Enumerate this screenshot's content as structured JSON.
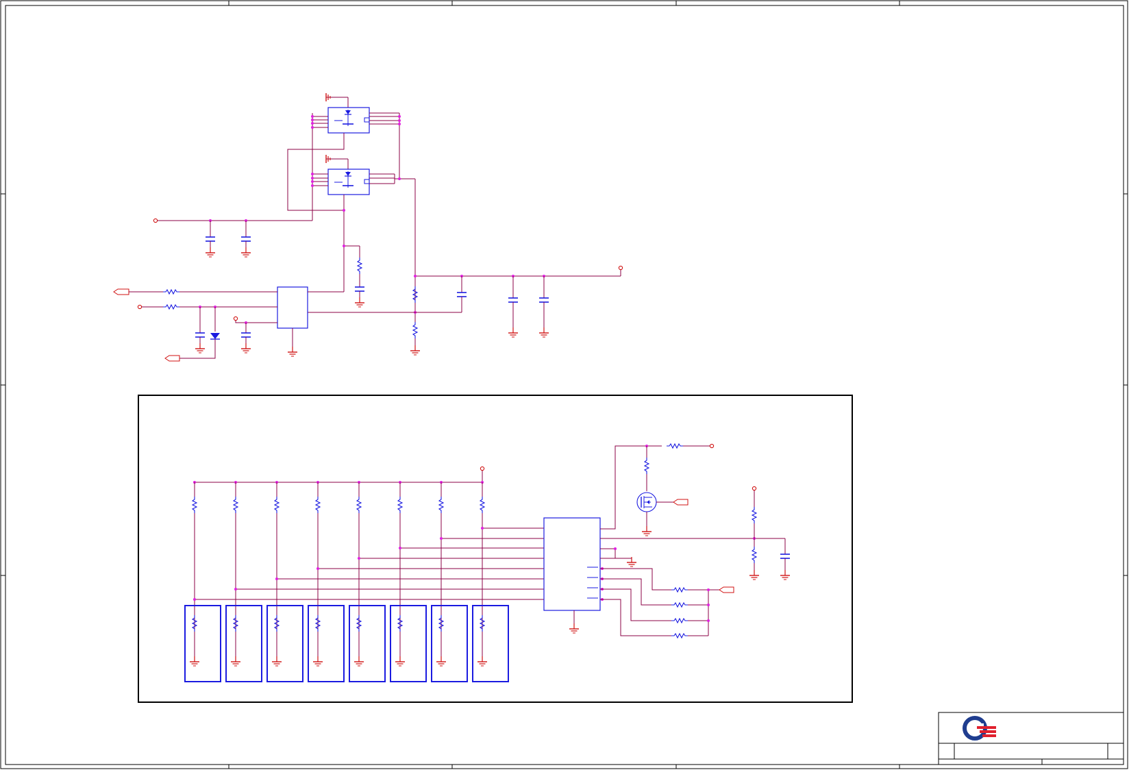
{
  "sheet": {
    "title": "",
    "border_color": "#000000",
    "wire_color": "#8b0045",
    "component_color": "#d01010",
    "symbol_color": "#1a1ae0",
    "junction_color": "#e020e0"
  },
  "title_block": {
    "logo": "quanta-logo",
    "logo_colors": [
      "#1f3d8f",
      "#e0202e"
    ]
  },
  "icons": [
    "ground-icon",
    "resistor-icon",
    "capacitor-icon",
    "diode-icon",
    "mosfet-icon",
    "port-icon",
    "power-pin-icon"
  ]
}
